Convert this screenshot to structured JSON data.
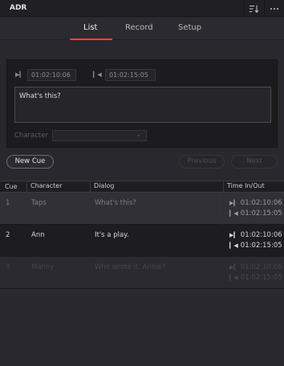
{
  "app": {
    "title": "ADR"
  },
  "toolbar": {
    "sort_icon": "sort-icon",
    "more_icon": "more-icon"
  },
  "tabs": [
    {
      "label": "List",
      "active": true
    },
    {
      "label": "Record",
      "active": false
    },
    {
      "label": "Setup",
      "active": false
    }
  ],
  "editor": {
    "time_in": "01:02:10:06",
    "time_out": "01:02:15:05",
    "dialog": "What's this?",
    "character_label": "Character",
    "character_value": ""
  },
  "buttons": {
    "new_cue": "New Cue",
    "previous": "Previous",
    "next": "Next"
  },
  "table": {
    "headers": [
      "Cue",
      "Character",
      "Dialog",
      "Time In/Out"
    ],
    "rows": [
      {
        "cue": "1",
        "character": "Taps",
        "dialog": "What's this?",
        "time_in": "01:02:10:06",
        "time_out": "01:02:15:05"
      },
      {
        "cue": "2",
        "character": "Ann",
        "dialog": "It's a play.",
        "time_in": "01:02:10:06",
        "time_out": "01:02:15:05"
      },
      {
        "cue": "3",
        "character": "Manny",
        "dialog": "Who wrote it, Annie?",
        "time_in": "01:02:10:06",
        "time_out": "01:02:15:05"
      }
    ]
  },
  "colors": {
    "accent": "#e0463c",
    "background": "#28282e"
  }
}
